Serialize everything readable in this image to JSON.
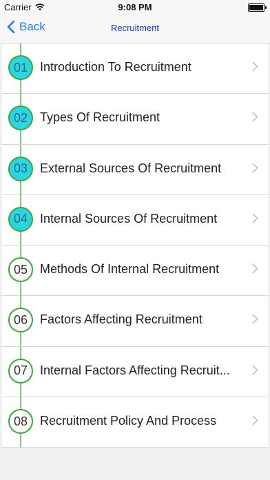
{
  "status_bar": {
    "carrier": "Carrier",
    "time": "9:08 PM"
  },
  "nav": {
    "back_label": "Back",
    "title": "Recruitment"
  },
  "items": [
    {
      "number": "01",
      "label": "Introduction To Recruitment",
      "style": "filled"
    },
    {
      "number": "02",
      "label": "Types Of Recruitment",
      "style": "filled"
    },
    {
      "number": "03",
      "label": "External Sources Of Recruitment",
      "style": "filled"
    },
    {
      "number": "04",
      "label": "Internal Sources Of Recruitment",
      "style": "filled"
    },
    {
      "number": "05",
      "label": "Methods Of Internal Recruitment",
      "style": "empty"
    },
    {
      "number": "06",
      "label": "Factors Affecting Recruitment",
      "style": "empty"
    },
    {
      "number": "07",
      "label": "Internal Factors Affecting Recruit...",
      "style": "empty"
    },
    {
      "number": "08",
      "label": "Recruitment Policy And Process",
      "style": "empty"
    }
  ],
  "colors": {
    "accent": "#1a7cf5",
    "title": "#1536c9",
    "circle_fill": "#2ad6e3",
    "circle_border": "#3aa739"
  }
}
